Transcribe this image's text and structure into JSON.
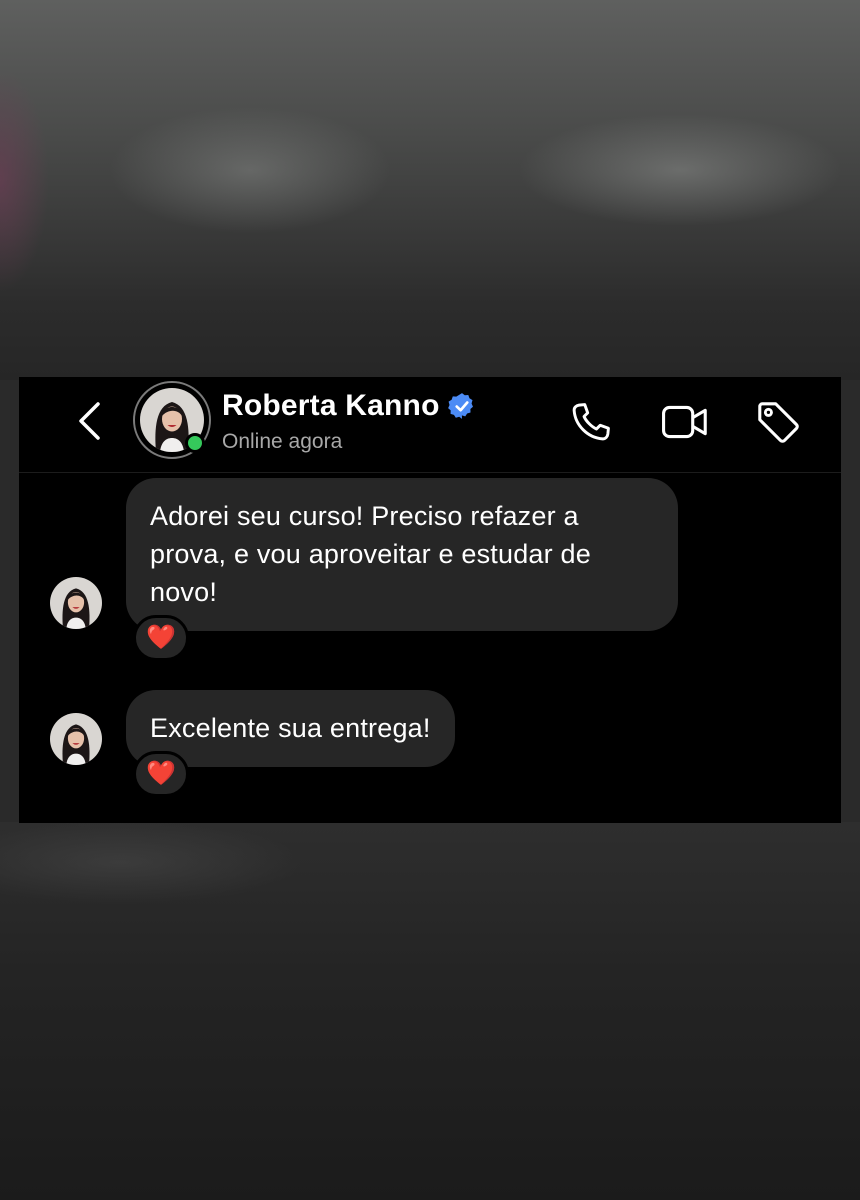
{
  "contact": {
    "name": "Roberta Kanno",
    "status": "Online agora",
    "verified": true,
    "online": true
  },
  "header": {
    "back_icon": "chevron-left-icon",
    "actions": [
      {
        "name": "call",
        "icon": "phone-icon"
      },
      {
        "name": "video",
        "icon": "video-camera-icon"
      },
      {
        "name": "tag",
        "icon": "tag-icon"
      }
    ]
  },
  "messages": [
    {
      "text": "Adorei seu curso! Preciso refazer a prova, e vou aproveitar e estudar de novo!",
      "lines": [
        "Adorei seu curso! Preciso refazer a",
        "prova, e vou aproveitar e estudar de",
        "novo!"
      ],
      "reaction": "❤️"
    },
    {
      "text": "Excelente sua entrega!",
      "lines": [
        "Excelente sua entrega!"
      ],
      "reaction": "❤️"
    }
  ],
  "colors": {
    "card_background": "#000000",
    "bubble": "#262626",
    "verified_badge": "#4c8bf5",
    "online_dot": "#35c95b",
    "secondary_text": "#a8a8a8"
  }
}
